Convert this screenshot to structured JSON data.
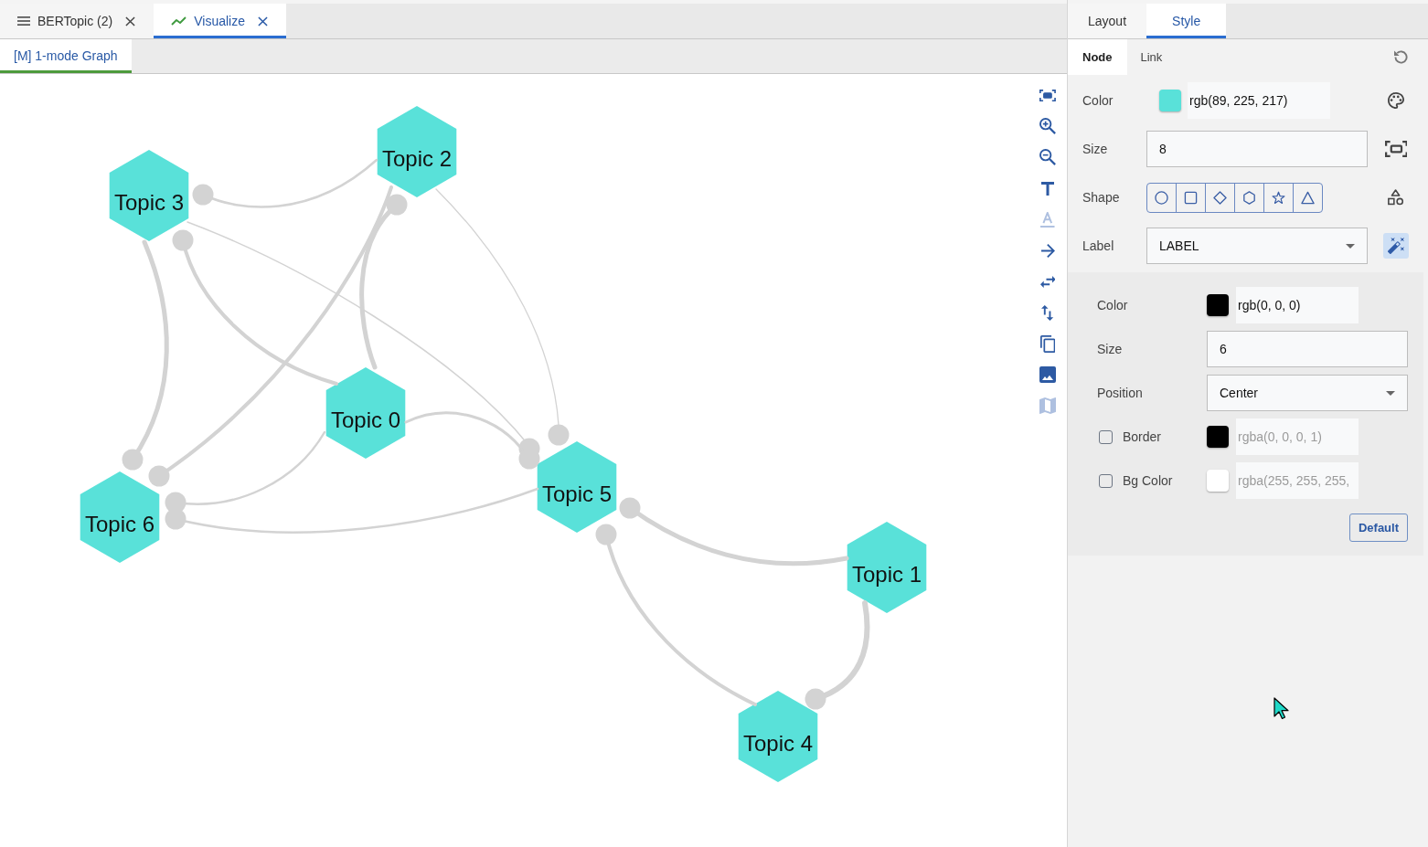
{
  "tabs": [
    {
      "label": "BERTopic (2)",
      "kind": "list",
      "selected": false
    },
    {
      "label": "Visualize",
      "kind": "chart",
      "selected": true
    }
  ],
  "view_tabs": [
    {
      "label": "[M] 1-mode Graph",
      "selected": true
    }
  ],
  "graph": {
    "nodes": [
      {
        "label": "Topic 2"
      },
      {
        "label": "Topic 3"
      },
      {
        "label": "Topic 0"
      },
      {
        "label": "Topic 5"
      },
      {
        "label": "Topic 6"
      },
      {
        "label": "Topic 1"
      },
      {
        "label": "Topic 4"
      }
    ]
  },
  "toolbar": [
    {
      "kind": "fit",
      "disabled": false
    },
    {
      "kind": "zoom-in",
      "disabled": false
    },
    {
      "kind": "zoom-out",
      "disabled": false
    },
    {
      "kind": "text",
      "disabled": false
    },
    {
      "kind": "text-color",
      "disabled": true
    },
    {
      "kind": "arrow",
      "disabled": false
    },
    {
      "kind": "swap-horizontal",
      "disabled": false
    },
    {
      "kind": "swap-vertical",
      "disabled": false
    },
    {
      "kind": "copy",
      "disabled": false
    },
    {
      "kind": "image",
      "disabled": false
    },
    {
      "kind": "map",
      "disabled": true
    }
  ],
  "panel": {
    "tabs": [
      {
        "label": "Layout",
        "selected": false
      },
      {
        "label": "Style",
        "selected": true
      }
    ],
    "subtabs": [
      {
        "label": "Node",
        "selected": true
      },
      {
        "label": "Link",
        "selected": false
      }
    ],
    "node_settings": [
      {
        "kind": "color",
        "label": "Color",
        "value": "rgb(89, 225, 217)",
        "color": "#59e1d9",
        "action": {
          "kind": "palette",
          "on": false
        }
      },
      {
        "kind": "number",
        "label": "Size",
        "value": "8",
        "action": {
          "kind": "fit",
          "on": false
        }
      },
      {
        "kind": "shape",
        "label": "Shape",
        "options": [
          {
            "kind": "circle"
          },
          {
            "kind": "square"
          },
          {
            "kind": "diamond"
          },
          {
            "kind": "hexagon"
          },
          {
            "kind": "star"
          },
          {
            "kind": "triangle"
          }
        ],
        "action": {
          "kind": "shapes",
          "on": false
        }
      },
      {
        "kind": "select",
        "label": "Label",
        "value": "LABEL",
        "action": {
          "kind": "wand",
          "on": true
        }
      }
    ],
    "label_settings": [
      {
        "kind": "color",
        "label": "Color",
        "value": "rgb(0, 0, 0)",
        "color": "#000000"
      },
      {
        "kind": "number",
        "label": "Size",
        "value": "6"
      },
      {
        "kind": "select",
        "label": "Position",
        "value": "Center"
      },
      {
        "kind": "toggle-color",
        "label": "Border",
        "checked": false,
        "value": "rgba(0, 0, 0, 1)",
        "color": "#000000"
      },
      {
        "kind": "toggle-color",
        "label": "Bg Color",
        "checked": false,
        "value": "rgba(255, 255, 255,",
        "color": "#ffffff"
      }
    ],
    "default_button": "Default"
  }
}
